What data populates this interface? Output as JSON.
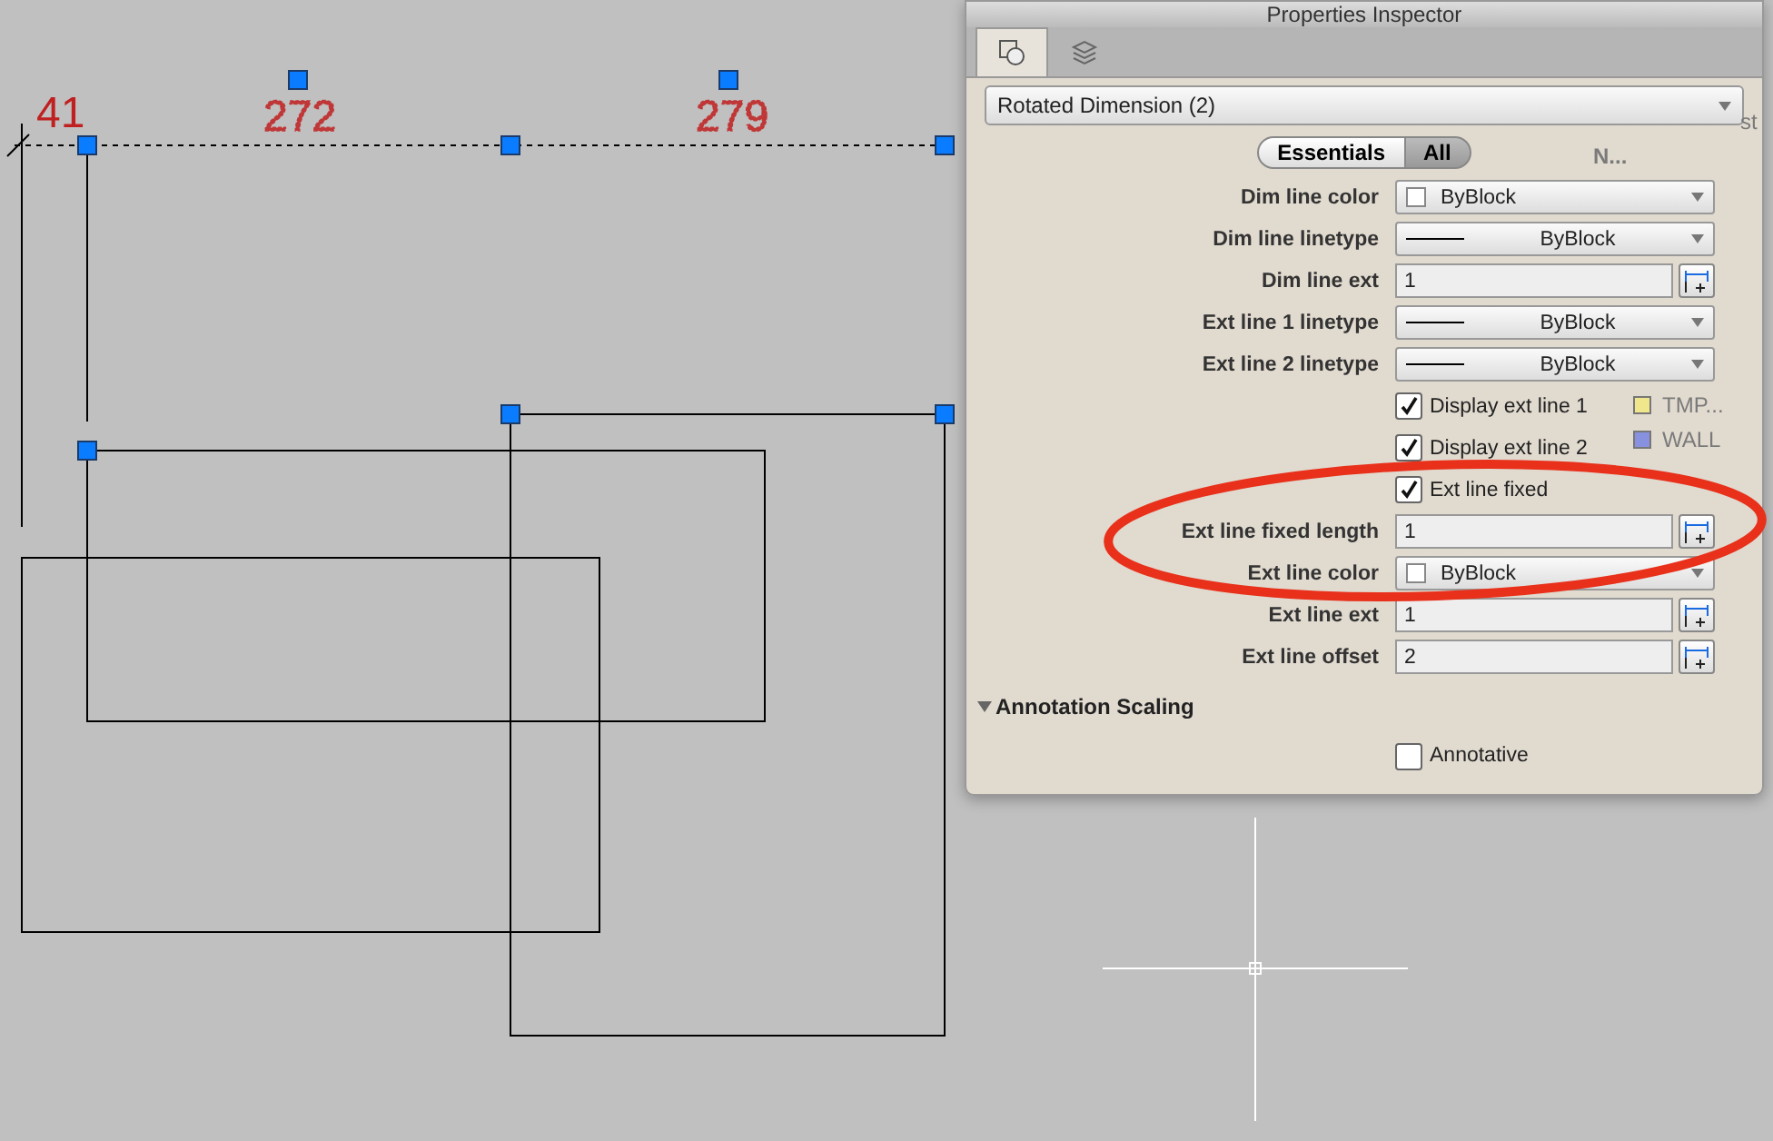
{
  "drawing": {
    "dimension_texts": [
      {
        "text": "41",
        "kind": "solid"
      },
      {
        "text": "272",
        "kind": "dotted"
      },
      {
        "text": "279",
        "kind": "dotted"
      }
    ]
  },
  "layers_palette": {
    "search_hint": "st",
    "header": "N...",
    "layers": [
      {
        "name": "TMP...",
        "color": "#f0e68c"
      },
      {
        "name": "WALL",
        "color": "#8890e0"
      }
    ]
  },
  "inspector": {
    "title": "Properties Inspector",
    "tabs": [
      {
        "kind": "objects",
        "selected": true
      },
      {
        "kind": "layers",
        "selected": false
      }
    ],
    "selection": "Rotated Dimension (2)",
    "view_modes": [
      {
        "label": "Essentials",
        "selected": false
      },
      {
        "label": "All",
        "selected": true
      }
    ],
    "rows": [
      {
        "kind": "color",
        "label": "Dim line color",
        "value": "ByBlock",
        "color": "#ffffff"
      },
      {
        "kind": "linetype",
        "label": "Dim line linetype",
        "value": "ByBlock"
      },
      {
        "kind": "number",
        "label": "Dim line ext",
        "value": "1"
      },
      {
        "kind": "linetype",
        "label": "Ext line 1 linetype",
        "value": "ByBlock"
      },
      {
        "kind": "linetype",
        "label": "Ext line 2 linetype",
        "value": "ByBlock"
      },
      {
        "kind": "checkbox",
        "label": "Display ext line 1",
        "checked": true
      },
      {
        "kind": "checkbox",
        "label": "Display ext line 2",
        "checked": true
      },
      {
        "kind": "checkbox",
        "label": "Ext line fixed",
        "checked": true
      },
      {
        "kind": "number",
        "label": "Ext line fixed length",
        "value": "1"
      },
      {
        "kind": "color",
        "label": "Ext line color",
        "value": "ByBlock",
        "color": "#ffffff"
      },
      {
        "kind": "number",
        "label": "Ext line ext",
        "value": "1"
      },
      {
        "kind": "number",
        "label": "Ext line offset",
        "value": "2"
      }
    ],
    "sections": [
      {
        "title": "Annotation Scaling",
        "expanded": true,
        "rows": [
          {
            "kind": "checkbox",
            "label": "Annotative",
            "checked": false
          }
        ]
      }
    ]
  }
}
